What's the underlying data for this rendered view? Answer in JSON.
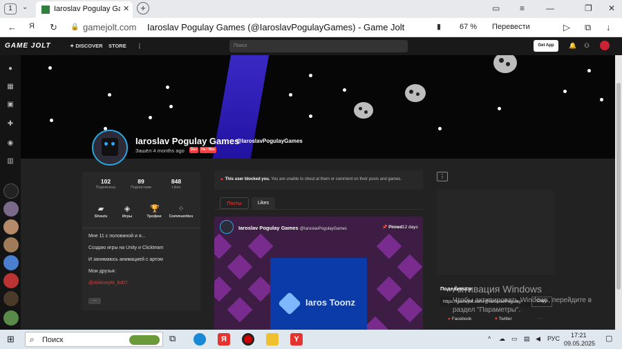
{
  "browser": {
    "tab_count": "1",
    "tab_title": "Iaroslav Pogulay Games",
    "domain": "gamejolt.com",
    "page_title": "Iaroslav Pogulay Games (@IaroslavPogulayGames) - Game Jolt",
    "zoom": "67 %",
    "translate_label": "Перевести"
  },
  "gj_nav": {
    "logo": "GAME JOLT",
    "discover": "DISCOVER",
    "store": "STORE",
    "search_placeholder": "Поиск",
    "get_app": "Get App"
  },
  "profile": {
    "name": "Iaroslav Pogulay Games",
    "handle": "@IaroslavPogulayGames",
    "joined": "Зашёл 4 months ago",
    "badge_dev": "Dev",
    "badge_follow": "He / Him",
    "stats": [
      {
        "value": "102",
        "label": "Подписаны"
      },
      {
        "value": "89",
        "label": "Подписчики"
      },
      {
        "value": "848",
        "label": "Likes"
      }
    ],
    "sections": [
      {
        "label": "Shouts"
      },
      {
        "label": "Игры"
      },
      {
        "label": "Трофеи"
      },
      {
        "label": "Communities"
      }
    ],
    "bio": [
      "Мне 11 с половиной и я...",
      "Создаю игры на Unity и Clickteam",
      "И занимаюсь анимацией с артом",
      "Мои друзья:",
      "@AlekseyM_8d07"
    ],
    "more_button": "···"
  },
  "center": {
    "blocked_bold": "This user blocked you.",
    "blocked_text": "You are unable to shout at them or comment on their posts and games.",
    "tabs": [
      "Посты",
      "Likes"
    ],
    "post": {
      "author": "Iaroslav Pogulay Games",
      "handle": "@IaroslavPogulayGames",
      "pinned": "Pinned",
      "age": "12 days",
      "image_text": "Iaros Toonz"
    }
  },
  "share": {
    "title": "Поделиться",
    "url": "https://gamejolt.com/@IaroslavPogulay",
    "copy": "Copy",
    "facebook": "Facebook",
    "twitter": "Twitter",
    "more": "···"
  },
  "watermark": {
    "line1": "Активация Windows",
    "line2": "Чтобы активировать Windows, перейдите в",
    "line3": "раздел \"Параметры\"."
  },
  "taskbar": {
    "search": "Поиск",
    "lang": "РУС",
    "time": "17:21",
    "date": "09.05.2025"
  },
  "colors": {
    "accent_red": "#ff3c3c",
    "accent_green": "#2f7f3f",
    "banner_bg": "#060607",
    "stripe": "#2a1cb8"
  }
}
